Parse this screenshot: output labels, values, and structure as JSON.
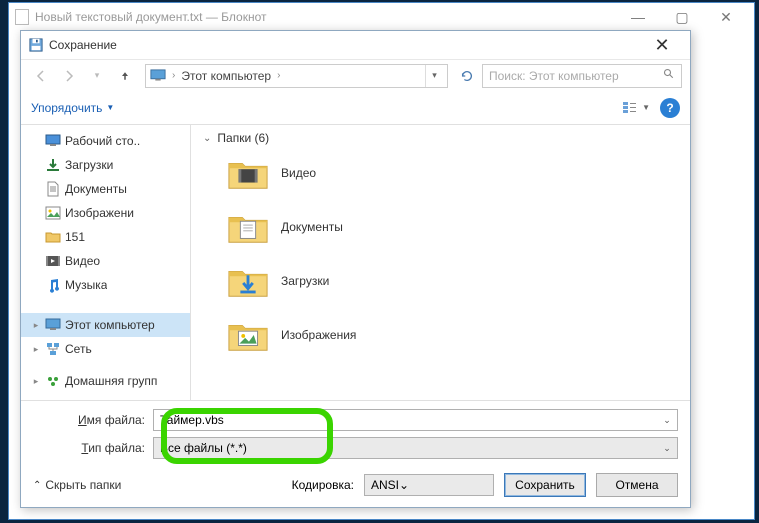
{
  "notepad": {
    "title": "Новый текстовый документ.txt — Блокнот"
  },
  "dialog": {
    "title": "Сохранение",
    "breadcrumb": "Этот компьютер",
    "search_placeholder": "Поиск: Этот компьютер",
    "organize": "Упорядочить",
    "group_header": "Папки (6)",
    "content_folders": [
      {
        "label": "Видео",
        "kind": "video"
      },
      {
        "label": "Документы",
        "kind": "docs"
      },
      {
        "label": "Загрузки",
        "kind": "downloads"
      },
      {
        "label": "Изображения",
        "kind": "images"
      }
    ],
    "tree": [
      {
        "label": "Рабочий сто..",
        "icon": "desktop",
        "twist": ""
      },
      {
        "label": "Загрузки",
        "icon": "downloads",
        "twist": ""
      },
      {
        "label": "Документы",
        "icon": "docs",
        "twist": ""
      },
      {
        "label": "Изображени",
        "icon": "images",
        "twist": ""
      },
      {
        "label": "151",
        "icon": "folder",
        "twist": ""
      },
      {
        "label": "Видео",
        "icon": "video",
        "twist": ""
      },
      {
        "label": "Музыка",
        "icon": "music",
        "twist": ""
      },
      {
        "label": "Этот компьютер",
        "icon": "pc",
        "twist": "▸",
        "selected": true
      },
      {
        "label": "Сеть",
        "icon": "network",
        "twist": "▸"
      },
      {
        "label": "Домашняя групп",
        "icon": "homegroup",
        "twist": "▸"
      }
    ],
    "filename_label": "Имя файла:",
    "filename_label_ul": "И",
    "filename_value": "Таймер.vbs",
    "filetype_label": "Тип файла:",
    "filetype_label_ul": "Т",
    "filetype_value": "Все файлы  (*.*)",
    "hide_folders": "Скрыть папки",
    "encoding_label": "Кодировка:",
    "encoding_value": "ANSI",
    "save_btn": "Сохранить",
    "cancel_btn": "Отмена"
  }
}
